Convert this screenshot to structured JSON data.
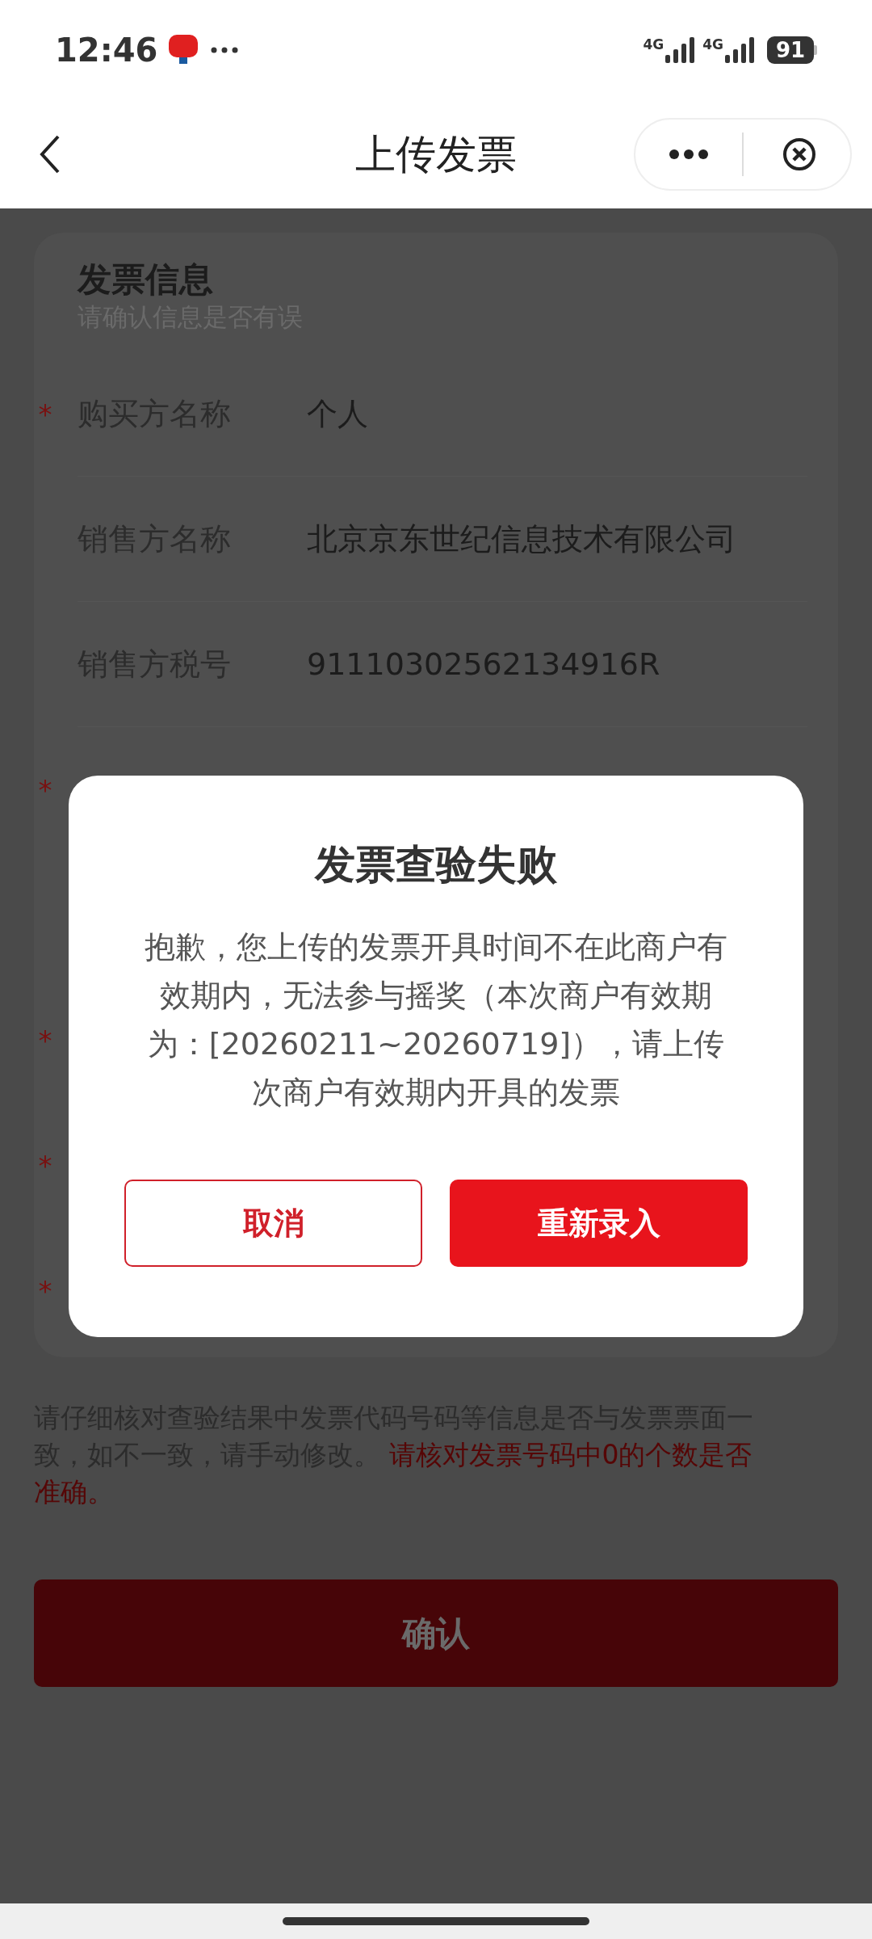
{
  "status_bar": {
    "time": "12:46",
    "network_labels": [
      "4G",
      "4G"
    ],
    "battery": "91"
  },
  "nav": {
    "title": "上传发票"
  },
  "card": {
    "title": "发票信息",
    "subtitle": "请确认信息是否有误",
    "rows": [
      {
        "mark": "*",
        "label": "购买方名称",
        "value": "个人"
      },
      {
        "label": "销售方名称",
        "value": "北京京东世纪信息技术有限公司"
      },
      {
        "label": "销售方税号",
        "value": "91110302562134916R"
      },
      {
        "mark": "*"
      },
      {
        "mark": "*"
      },
      {
        "mark": "*"
      },
      {
        "mark": "*"
      }
    ]
  },
  "note": {
    "text": "请仔细核对查验结果中发票代码号码等信息是否与发票票面一致，如不一致，请手动修改。",
    "warning": "请核对发票号码中0的个数是否准确。"
  },
  "confirm_button": "确认",
  "dialog": {
    "title": "发票查验失败",
    "message": "抱歉，您上传的发票开具时间不在此商户有效期内，无法参与摇奖（本次商户有效期为：[20260211~20260719]），请上传次商户有效期内开具的发票",
    "buttons": [
      {
        "label": "取消",
        "kind": "secondary"
      },
      {
        "label": "重新录入",
        "kind": "primary"
      }
    ]
  }
}
